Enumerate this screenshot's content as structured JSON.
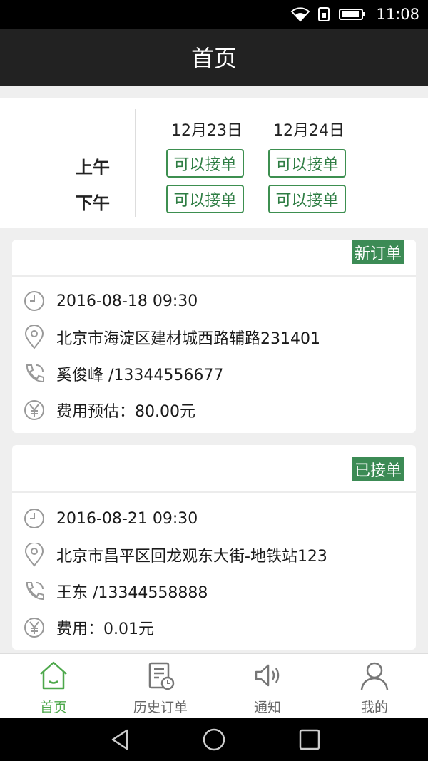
{
  "status_bar": {
    "time": "11:08",
    "icons": [
      "wifi-icon",
      "sim-icon",
      "battery-icon"
    ]
  },
  "header": {
    "title": "首页"
  },
  "schedule": {
    "dates": [
      "12月23日",
      "12月24日"
    ],
    "periods": [
      "上午",
      "下午"
    ],
    "slots": [
      [
        "可以接单",
        "可以接单"
      ],
      [
        "可以接单",
        "可以接单"
      ]
    ]
  },
  "orders": [
    {
      "status": "新订单",
      "time": "2016-08-18 09:30",
      "address": "北京市海淀区建材城西路辅路231401",
      "contact": "奚俊峰 /13344556677",
      "fee": "费用预估：80.00元"
    },
    {
      "status": "已接单",
      "time": "2016-08-21 09:30",
      "address": "北京市昌平区回龙观东大街-地铁站123",
      "contact": "王东 /13344558888",
      "fee": "费用：0.01元"
    }
  ],
  "tabs": [
    {
      "label": "首页",
      "icon": "home-icon",
      "active": true
    },
    {
      "label": "历史订单",
      "icon": "history-orders-icon",
      "active": false
    },
    {
      "label": "通知",
      "icon": "speaker-icon",
      "active": false
    },
    {
      "label": "我的",
      "icon": "person-icon",
      "active": false
    }
  ],
  "colors": {
    "accent_green": "#3c8b55",
    "tab_active": "#4da84b",
    "title_bar": "#222222"
  }
}
